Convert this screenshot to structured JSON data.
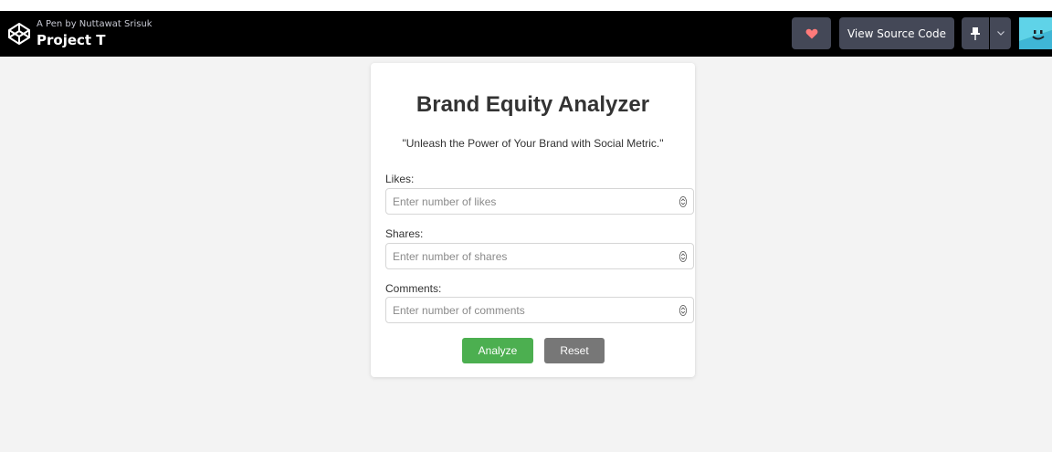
{
  "header": {
    "byline": "A Pen by Nuttawat Srisuk",
    "title": "Project T",
    "view_source_label": "View Source Code",
    "heart_color": "#ff7a7a",
    "bar_color": "#000000",
    "button_color": "#444857",
    "icons": [
      "codepen-logo-icon",
      "heart-icon",
      "pin-icon",
      "chevron-down-icon",
      "avatar"
    ]
  },
  "card": {
    "title": "Brand Equity Analyzer",
    "subtitle": "\"Unleash the Power of Your Brand with Social Metric.\"",
    "fields": [
      {
        "label": "Likes:",
        "placeholder": "Enter number of likes"
      },
      {
        "label": "Shares:",
        "placeholder": "Enter number of shares"
      },
      {
        "label": "Comments:",
        "placeholder": "Enter number of comments"
      }
    ],
    "analyze_label": "Analyze",
    "reset_label": "Reset",
    "analyze_color": "#4caf50",
    "reset_color": "#777777"
  }
}
